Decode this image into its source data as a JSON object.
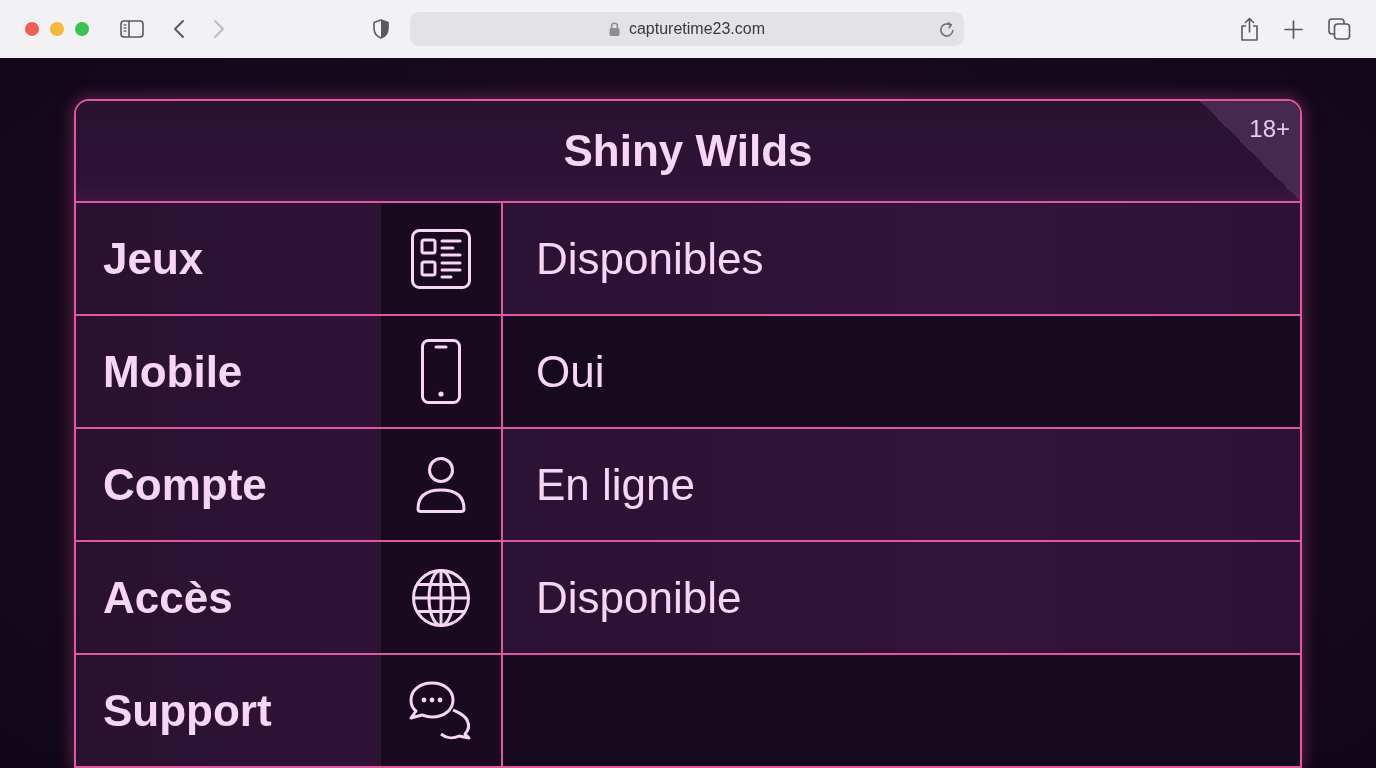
{
  "browser": {
    "url": "capturetime23.com",
    "back": {
      "disabled": false
    },
    "forward": {
      "disabled": true
    }
  },
  "card": {
    "title": "Shiny Wilds",
    "badge": "18+",
    "rows": [
      {
        "label": "Jeux",
        "value": "Disponibles",
        "shaded": false
      },
      {
        "label": "Mobile",
        "value": "Oui",
        "shaded": true
      },
      {
        "label": "Compte",
        "value": "En ligne",
        "shaded": false
      },
      {
        "label": "Accès",
        "value": "Disponible",
        "shaded": false
      },
      {
        "label": "Support",
        "shaded": true
      }
    ]
  }
}
